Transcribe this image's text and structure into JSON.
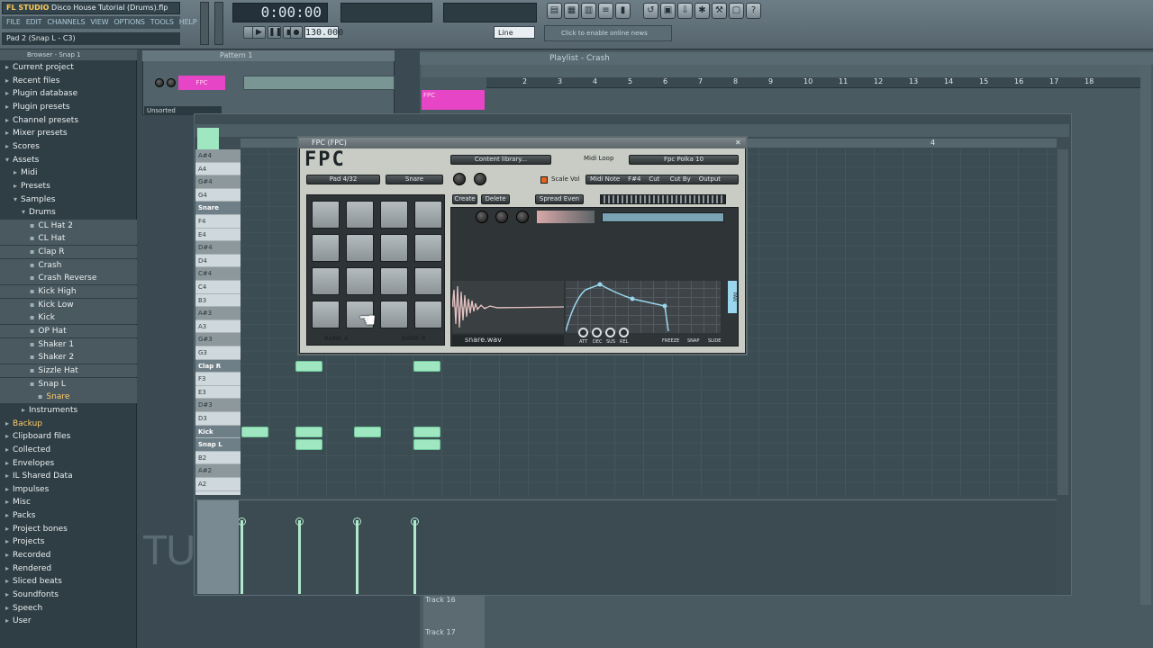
{
  "app": {
    "title": "Disco House Tutorial (Drums).flp",
    "menu": [
      "FILE",
      "EDIT",
      "CHANNELS",
      "VIEW",
      "OPTIONS",
      "TOOLS",
      "HELP"
    ],
    "hint": "Pad 2 (Snap L - C3)",
    "time": "0:00:00",
    "tempo": "130.000",
    "snap": "Line",
    "news": "Click to enable online news"
  },
  "browser": {
    "header": "Browser - Snap 1",
    "items": [
      {
        "label": "Current project",
        "indent": 0,
        "icon": "folder-icon"
      },
      {
        "label": "Recent files",
        "indent": 0,
        "icon": "folder-icon"
      },
      {
        "label": "Plugin database",
        "indent": 0,
        "icon": "folder-icon"
      },
      {
        "label": "Plugin presets",
        "indent": 0,
        "icon": "folder-icon"
      },
      {
        "label": "Channel presets",
        "indent": 0,
        "icon": "folder-icon"
      },
      {
        "label": "Mixer presets",
        "indent": 0,
        "icon": "folder-icon"
      },
      {
        "label": "Scores",
        "indent": 0,
        "icon": "folder-icon"
      },
      {
        "label": "Assets",
        "indent": 0,
        "icon": "folder-open-icon"
      },
      {
        "label": "Midi",
        "indent": 1,
        "icon": "folder-icon"
      },
      {
        "label": "Presets",
        "indent": 1,
        "icon": "folder-icon"
      },
      {
        "label": "Samples",
        "indent": 1,
        "icon": "folder-open-icon"
      },
      {
        "label": "Drums",
        "indent": 2,
        "icon": "folder-open-icon"
      },
      {
        "label": "CL Hat 2",
        "indent": 3,
        "icon": "file-icon"
      },
      {
        "label": "CL Hat",
        "indent": 3,
        "icon": "file-icon"
      },
      {
        "label": "Clap R",
        "indent": 3,
        "icon": "file-icon"
      },
      {
        "label": "Crash",
        "indent": 3,
        "icon": "file-icon"
      },
      {
        "label": "Crash Reverse",
        "indent": 3,
        "icon": "file-icon"
      },
      {
        "label": "Kick High",
        "indent": 3,
        "icon": "file-icon"
      },
      {
        "label": "Kick Low",
        "indent": 3,
        "icon": "file-icon"
      },
      {
        "label": "Kick",
        "indent": 3,
        "icon": "file-icon"
      },
      {
        "label": "OP Hat",
        "indent": 3,
        "icon": "file-icon"
      },
      {
        "label": "Shaker 1",
        "indent": 3,
        "icon": "file-icon"
      },
      {
        "label": "Shaker 2",
        "indent": 3,
        "icon": "file-icon"
      },
      {
        "label": "Sizzle Hat",
        "indent": 3,
        "icon": "file-icon"
      },
      {
        "label": "Snap L",
        "indent": 3,
        "icon": "file-icon"
      },
      {
        "label": "Snare",
        "indent": 4,
        "icon": "file-icon",
        "selected": true
      },
      {
        "label": "Instruments",
        "indent": 2,
        "icon": "folder-icon"
      },
      {
        "label": "Backup",
        "indent": 0,
        "icon": "folder-icon",
        "selected": true
      },
      {
        "label": "Clipboard files",
        "indent": 0,
        "icon": "folder-icon"
      },
      {
        "label": "Collected",
        "indent": 0,
        "icon": "folder-icon"
      },
      {
        "label": "Envelopes",
        "indent": 0,
        "icon": "folder-icon"
      },
      {
        "label": "IL Shared Data",
        "indent": 0,
        "icon": "folder-icon"
      },
      {
        "label": "Impulses",
        "indent": 0,
        "icon": "folder-icon"
      },
      {
        "label": "Misc",
        "indent": 0,
        "icon": "folder-icon"
      },
      {
        "label": "Packs",
        "indent": 0,
        "icon": "folder-icon"
      },
      {
        "label": "Project bones",
        "indent": 0,
        "icon": "folder-icon"
      },
      {
        "label": "Projects",
        "indent": 0,
        "icon": "folder-icon"
      },
      {
        "label": "Recorded",
        "indent": 0,
        "icon": "folder-icon"
      },
      {
        "label": "Rendered",
        "indent": 0,
        "icon": "folder-icon"
      },
      {
        "label": "Sliced beats",
        "indent": 0,
        "icon": "folder-icon"
      },
      {
        "label": "Soundfonts",
        "indent": 0,
        "icon": "folder-icon"
      },
      {
        "label": "Speech",
        "indent": 0,
        "icon": "folder-icon"
      },
      {
        "label": "User",
        "indent": 0,
        "icon": "folder-icon"
      }
    ]
  },
  "rack": {
    "title": "Pattern 1",
    "channel": "FPC",
    "filter": "Unsorted"
  },
  "playlist": {
    "title": "Playlist - Crash",
    "ruler": [
      "2",
      "3",
      "4",
      "5",
      "6",
      "7",
      "8",
      "9",
      "10",
      "11",
      "12",
      "13",
      "14",
      "15",
      "16",
      "17",
      "18"
    ],
    "track1": "FPC",
    "track16": "Track 16",
    "track17": "Track 17"
  },
  "piano": {
    "keys": [
      {
        "label": "A#4",
        "black": true
      },
      {
        "label": "A4"
      },
      {
        "label": "G#4",
        "black": true
      },
      {
        "label": "G4"
      },
      {
        "label": "Snare",
        "hl": true
      },
      {
        "label": "F4"
      },
      {
        "label": "E4"
      },
      {
        "label": "D#4",
        "black": true
      },
      {
        "label": "D4"
      },
      {
        "label": "C#4",
        "black": true
      },
      {
        "label": "C4"
      },
      {
        "label": "B3"
      },
      {
        "label": "A#3",
        "black": true
      },
      {
        "label": "A3"
      },
      {
        "label": "G#3",
        "black": true
      },
      {
        "label": "G3"
      },
      {
        "label": "Clap R",
        "hl": true
      },
      {
        "label": "F3"
      },
      {
        "label": "E3"
      },
      {
        "label": "D#3",
        "black": true
      },
      {
        "label": "D3"
      },
      {
        "label": "Kick",
        "hl": true
      },
      {
        "label": "Snap L",
        "hl": true
      },
      {
        "label": "B2"
      },
      {
        "label": "A#2",
        "black": true
      },
      {
        "label": "A2"
      }
    ],
    "ruler_marker": "4",
    "notes": [
      {
        "row": 16,
        "step": 2
      },
      {
        "row": 16,
        "step": 6
      },
      {
        "row": 21,
        "step": 0
      },
      {
        "row": 21,
        "step": 2
      },
      {
        "row": 21,
        "step": 4
      },
      {
        "row": 21,
        "step": 6
      },
      {
        "row": 22,
        "step": 2
      },
      {
        "row": 22,
        "step": 6
      }
    ],
    "velocities": [
      0,
      2,
      4,
      6
    ],
    "watermark": "TU"
  },
  "fpc": {
    "title": "FPC (FPC)",
    "logo": "FPC",
    "content_library": "Content library...",
    "midi_loop": "Midi Loop",
    "preset": "Fpc Polka 10",
    "pad": "Pad 4/32",
    "layer": "Snare",
    "scale_vol": "Scale Vol",
    "midi_note_label": "Midi Note",
    "midi_note": "F#4",
    "cut": "Cut",
    "cut_by": "Cut By",
    "output": "Output",
    "create": "Create",
    "delete": "Delete",
    "spread_even": "Spread Even",
    "bank_a": "BANK A",
    "bank_b": "BANK B",
    "sample": "snare.wav",
    "env_labels": [
      "ATT",
      "DEC",
      "SUS",
      "REL"
    ],
    "freeze": "FREEZE",
    "snap": "SNAP",
    "slide": "SLIDE",
    "pan_label": "PAN"
  }
}
